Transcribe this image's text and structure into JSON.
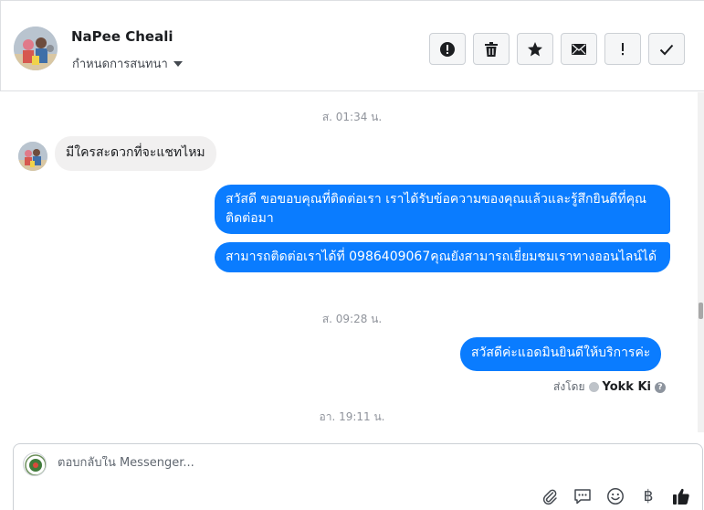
{
  "header": {
    "contact_name": "NaPee Cheali",
    "conversation_setting": "กำหนดการสนทนา",
    "actions": [
      {
        "name": "report-spam-button",
        "icon": "exclamation-circle-icon"
      },
      {
        "name": "delete-button",
        "icon": "trash-icon"
      },
      {
        "name": "star-button",
        "icon": "star-icon"
      },
      {
        "name": "mark-unread-button",
        "icon": "envelope-icon"
      },
      {
        "name": "follow-up-button",
        "icon": "exclamation-icon"
      },
      {
        "name": "mark-done-button",
        "icon": "check-icon"
      }
    ]
  },
  "thread": {
    "cut_text": "·",
    "timestamps": [
      "ส. 01:34 น.",
      "ส. 09:28 น.",
      "อา. 19:11 น."
    ],
    "messages": [
      {
        "direction": "in",
        "text": "มีใครสะดวกที่จะแชทไหม"
      },
      {
        "direction": "out",
        "text": "สวัสดี ขอขอบคุณที่ติดต่อเรา เราได้รับข้อความของคุณแล้วและรู้สึกยินดีที่คุณติดต่อมา"
      },
      {
        "direction": "out",
        "text": "สามารถติดต่อเราได้ที่ 0986409067คุณยังสามารถเยี่ยมชมเราทางออนไลน์ได้"
      },
      {
        "direction": "out",
        "text": "สวัสดีค่ะแอดมินยินดีให้บริการค่ะ"
      }
    ],
    "sent_by_label": "ส่งโดย",
    "sent_by_name": "Yokk Ki",
    "help_glyph": "?"
  },
  "composer": {
    "placeholder": "ตอบกลับใน Messenger...",
    "tools": [
      "paperclip-icon",
      "saved-replies-icon",
      "emoji-icon",
      "baht-icon",
      "thumbs-up-icon"
    ],
    "baht_glyph": "฿"
  },
  "colors": {
    "outgoing_bubble": "#0a7cff",
    "incoming_bubble": "#f1f0f0",
    "like_button": "#1c1e21"
  }
}
